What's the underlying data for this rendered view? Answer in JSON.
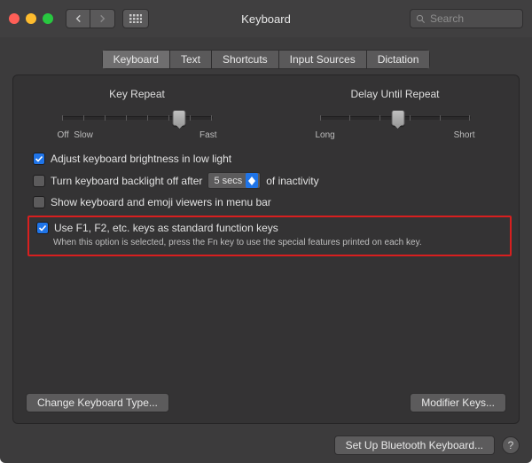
{
  "window": {
    "title": "Keyboard"
  },
  "search": {
    "placeholder": "Search"
  },
  "tabs": [
    "Keyboard",
    "Text",
    "Shortcuts",
    "Input Sources",
    "Dictation"
  ],
  "active_tab": 0,
  "sliders": {
    "key_repeat": {
      "label": "Key Repeat",
      "left": "Off",
      "left2": "Slow",
      "right": "Fast",
      "pos": 0.78
    },
    "delay": {
      "label": "Delay Until Repeat",
      "left": "Long",
      "right": "Short",
      "pos": 0.52
    }
  },
  "options": {
    "adjust_brightness": {
      "checked": true,
      "label": "Adjust keyboard brightness in low light"
    },
    "backlight_off": {
      "checked": false,
      "prefix": "Turn keyboard backlight off after",
      "value": "5 secs",
      "suffix": "of inactivity"
    },
    "show_viewers": {
      "checked": false,
      "label": "Show keyboard and emoji viewers in menu bar"
    },
    "fn_keys": {
      "checked": true,
      "label": "Use F1, F2, etc. keys as standard function keys",
      "sub": "When this option is selected, press the Fn key to use the special features printed on each key."
    }
  },
  "buttons": {
    "change_type": "Change Keyboard Type...",
    "modifier": "Modifier Keys...",
    "bluetooth": "Set Up Bluetooth Keyboard..."
  }
}
